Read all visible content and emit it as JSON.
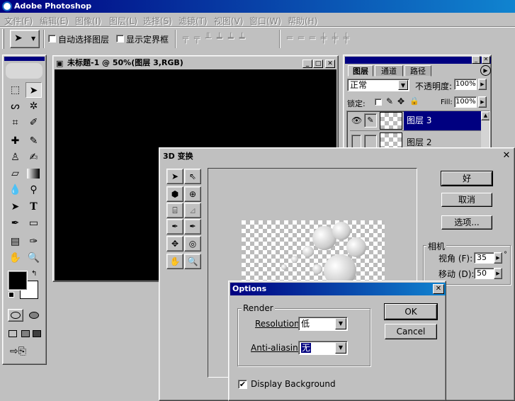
{
  "app": {
    "title": "Adobe Photoshop"
  },
  "menu": {
    "items": [
      "文件(F)",
      "编辑(E)",
      "图像(I)",
      "图层(L)",
      "选择(S)",
      "滤镜(T)",
      "视图(V)",
      "窗口(W)",
      "帮助(H)"
    ]
  },
  "options_bar": {
    "auto_select_layer": "自动选择图层",
    "show_bounding_box": "显示定界框"
  },
  "document": {
    "title": "未标题-1 @ 50%(图层 3,RGB)"
  },
  "layers_palette": {
    "tabs": [
      "图层",
      "通道",
      "路径"
    ],
    "blend_mode": "正常",
    "opacity_label": "不透明度:",
    "opacity_value": "100%",
    "lock_label": "锁定:",
    "fill_label": "Fill:",
    "fill_value": "100%",
    "layers": [
      "图层 3",
      "图层 2"
    ]
  },
  "dialog_3d": {
    "title": "3D 变换",
    "ok_label": "好",
    "cancel_label": "取消",
    "options_label": "选项...",
    "camera_group": "相机",
    "fov_label": "视角 (F):",
    "fov_value": "35",
    "fov_unit": "°",
    "dolly_label": "移动 (D):",
    "dolly_value": "50"
  },
  "dialog_options": {
    "title": "Options",
    "render_group": "Render",
    "resolution_label": "Resolution:",
    "resolution_value": "低",
    "antialias_label": "Anti-aliasing:",
    "antialias_value": "无",
    "ok_label": "OK",
    "cancel_label": "Cancel",
    "display_background_label": "Display Background",
    "display_background_checked": true
  }
}
